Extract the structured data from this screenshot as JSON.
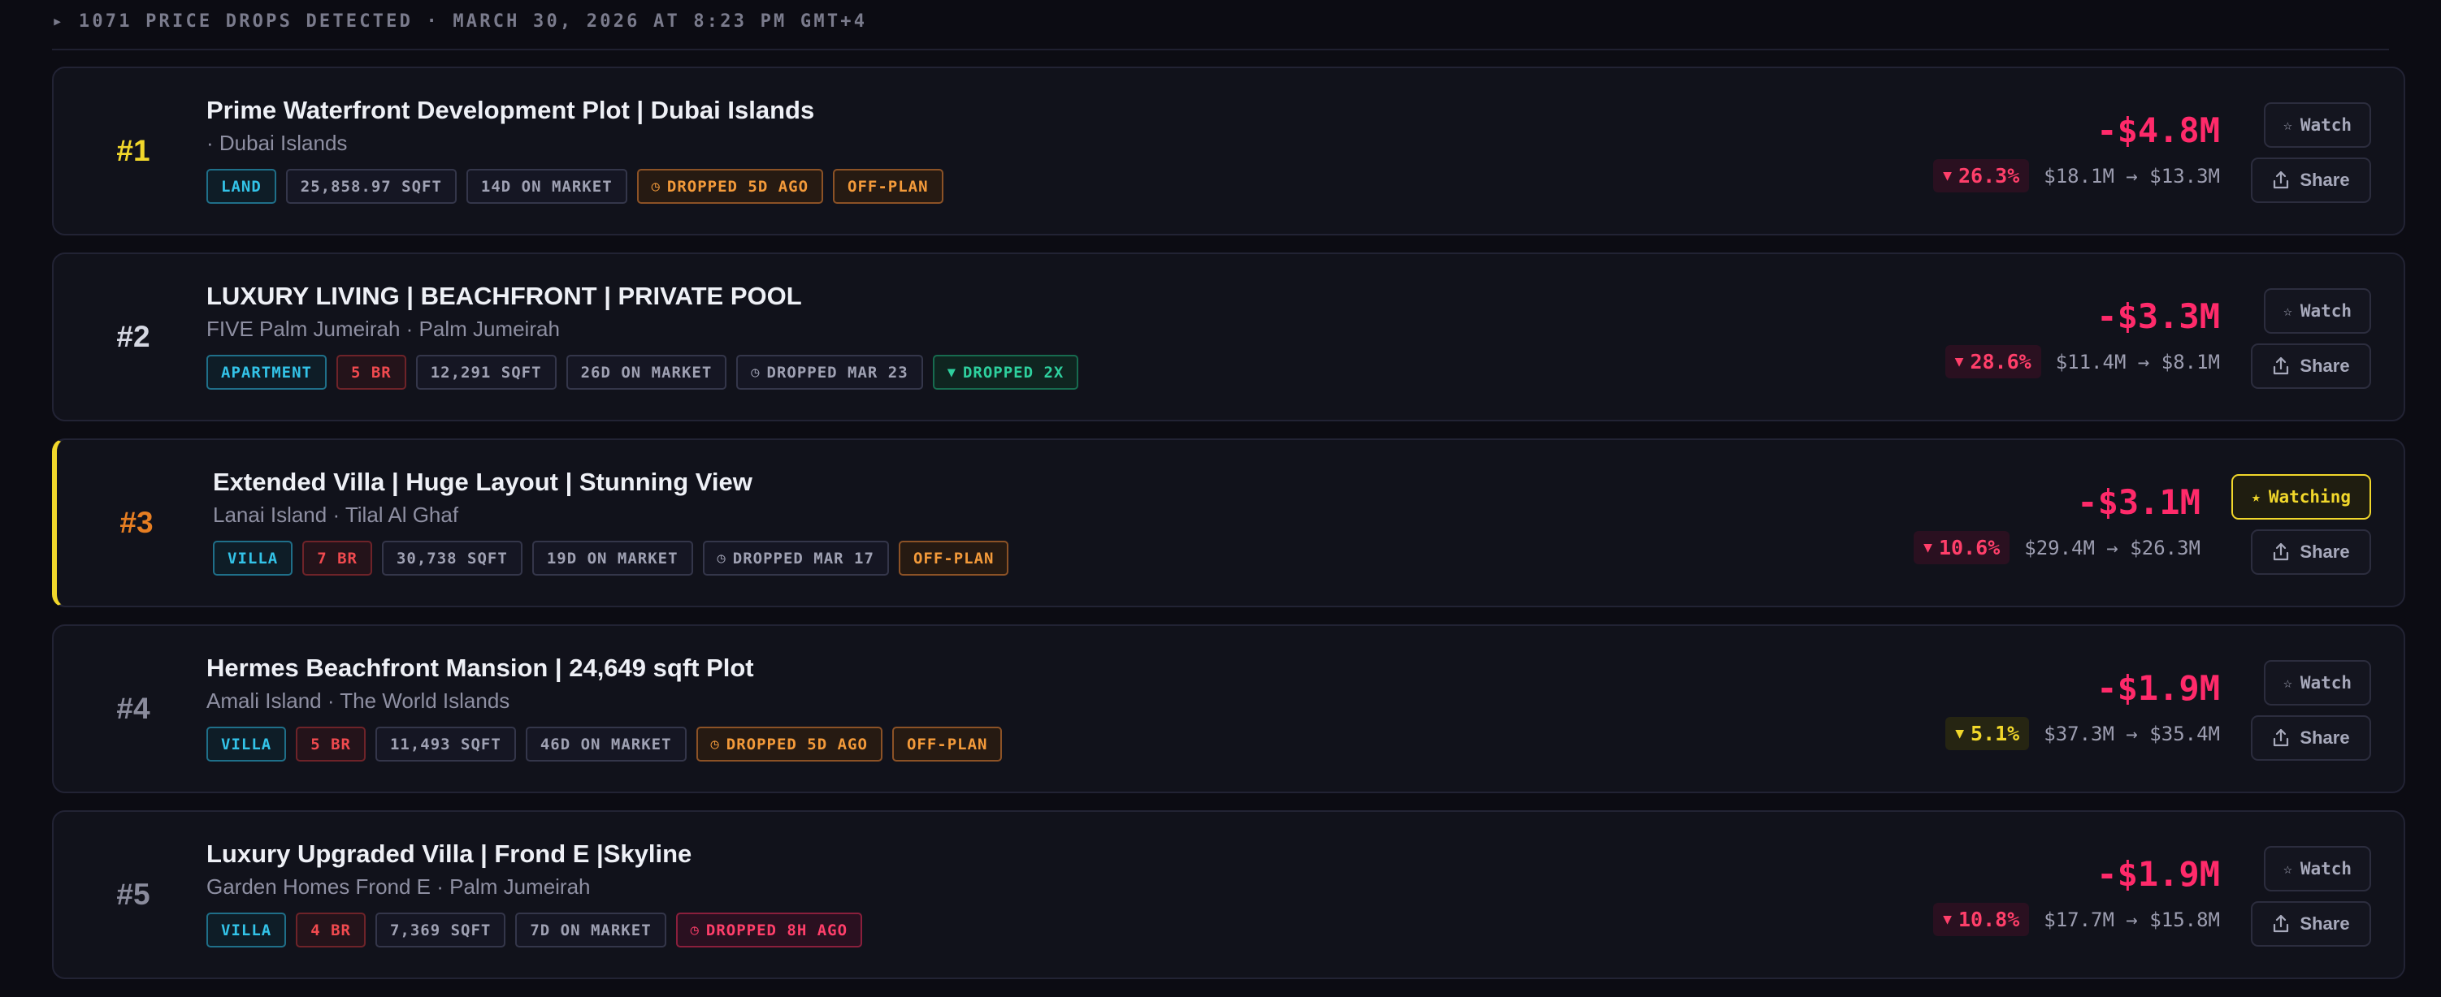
{
  "header": {
    "summary": "▸ 1071 PRICE DROPS DETECTED · MARCH 30, 2026 AT 8:23 PM GMT+4"
  },
  "colors": {
    "accent_pink": "#ff2a6a",
    "watch_yellow": "#f1d72b",
    "rank1_gold": "#f1d72b",
    "rank3_orange": "#e67e22",
    "tag_cyan": "#33c3e8",
    "tag_red": "#f04a4f",
    "tag_orange": "#f39a3a",
    "tag_green": "#2ed09e"
  },
  "listings": [
    {
      "rank": "#1",
      "title": "Prime Waterfront Development Plot | Dubai Islands",
      "location": "· Dubai Islands",
      "tags": [
        {
          "label": "LAND",
          "style": "cyan"
        },
        {
          "label": "25,858.97 SQFT",
          "style": "gray"
        },
        {
          "label": "14D ON MARKET",
          "style": "gray"
        },
        {
          "label": "DROPPED 5D AGO",
          "style": "orange",
          "icon": "clock-icon"
        },
        {
          "label": "OFF-PLAN",
          "style": "orange"
        }
      ],
      "drop_amount": "-$4.8M",
      "drop_percent": "26.3%",
      "price_change": "$18.1M → $13.3M",
      "watch_label": "Watch",
      "share_label": "Share"
    },
    {
      "rank": "#2",
      "title": "LUXURY LIVING | BEACHFRONT | PRIVATE POOL",
      "location": "FIVE Palm Jumeirah · Palm Jumeirah",
      "tags": [
        {
          "label": "APARTMENT",
          "style": "cyan"
        },
        {
          "label": "5 BR",
          "style": "red"
        },
        {
          "label": "12,291 SQFT",
          "style": "gray"
        },
        {
          "label": "26D ON MARKET",
          "style": "gray"
        },
        {
          "label": "DROPPED MAR 23",
          "style": "gray",
          "icon": "clock-icon"
        },
        {
          "label": "DROPPED 2X",
          "style": "green",
          "icon": "triangle-down-icon"
        }
      ],
      "drop_amount": "-$3.3M",
      "drop_percent": "28.6%",
      "price_change": "$11.4M → $8.1M",
      "watch_label": "Watch",
      "share_label": "Share"
    },
    {
      "rank": "#3",
      "title": "Extended Villa | Huge Layout | Stunning View",
      "location": "Lanai Island · Tilal Al Ghaf",
      "tags": [
        {
          "label": "VILLA",
          "style": "cyan"
        },
        {
          "label": "7 BR",
          "style": "red"
        },
        {
          "label": "30,738 SQFT",
          "style": "gray"
        },
        {
          "label": "19D ON MARKET",
          "style": "gray"
        },
        {
          "label": "DROPPED MAR 17",
          "style": "gray",
          "icon": "clock-icon"
        },
        {
          "label": "OFF-PLAN",
          "style": "orange"
        }
      ],
      "drop_amount": "-$3.1M",
      "drop_percent": "10.6%",
      "price_change": "$29.4M → $26.3M",
      "watch_label": "Watching",
      "share_label": "Share"
    },
    {
      "rank": "#4",
      "title": "Hermes Beachfront Mansion | 24,649 sqft Plot",
      "location": "Amali Island · The World Islands",
      "tags": [
        {
          "label": "VILLA",
          "style": "cyan"
        },
        {
          "label": "5 BR",
          "style": "red"
        },
        {
          "label": "11,493 SQFT",
          "style": "gray"
        },
        {
          "label": "46D ON MARKET",
          "style": "gray"
        },
        {
          "label": "DROPPED 5D AGO",
          "style": "orange",
          "icon": "clock-icon"
        },
        {
          "label": "OFF-PLAN",
          "style": "orange"
        }
      ],
      "drop_amount": "-$1.9M",
      "drop_percent": "5.1%",
      "price_change": "$37.3M → $35.4M",
      "watch_label": "Watch",
      "share_label": "Share"
    },
    {
      "rank": "#5",
      "title": "Luxury Upgraded Villa | Frond E |Skyline",
      "location": "Garden Homes Frond E · Palm Jumeirah",
      "tags": [
        {
          "label": "VILLA",
          "style": "cyan"
        },
        {
          "label": "4 BR",
          "style": "red"
        },
        {
          "label": "7,369 SQFT",
          "style": "gray"
        },
        {
          "label": "7D ON MARKET",
          "style": "gray"
        },
        {
          "label": "DROPPED 8H AGO",
          "style": "pink",
          "icon": "clock-icon"
        }
      ],
      "drop_amount": "-$1.9M",
      "drop_percent": "10.8%",
      "price_change": "$17.7M → $15.8M",
      "watch_label": "Watch",
      "share_label": "Share"
    }
  ]
}
